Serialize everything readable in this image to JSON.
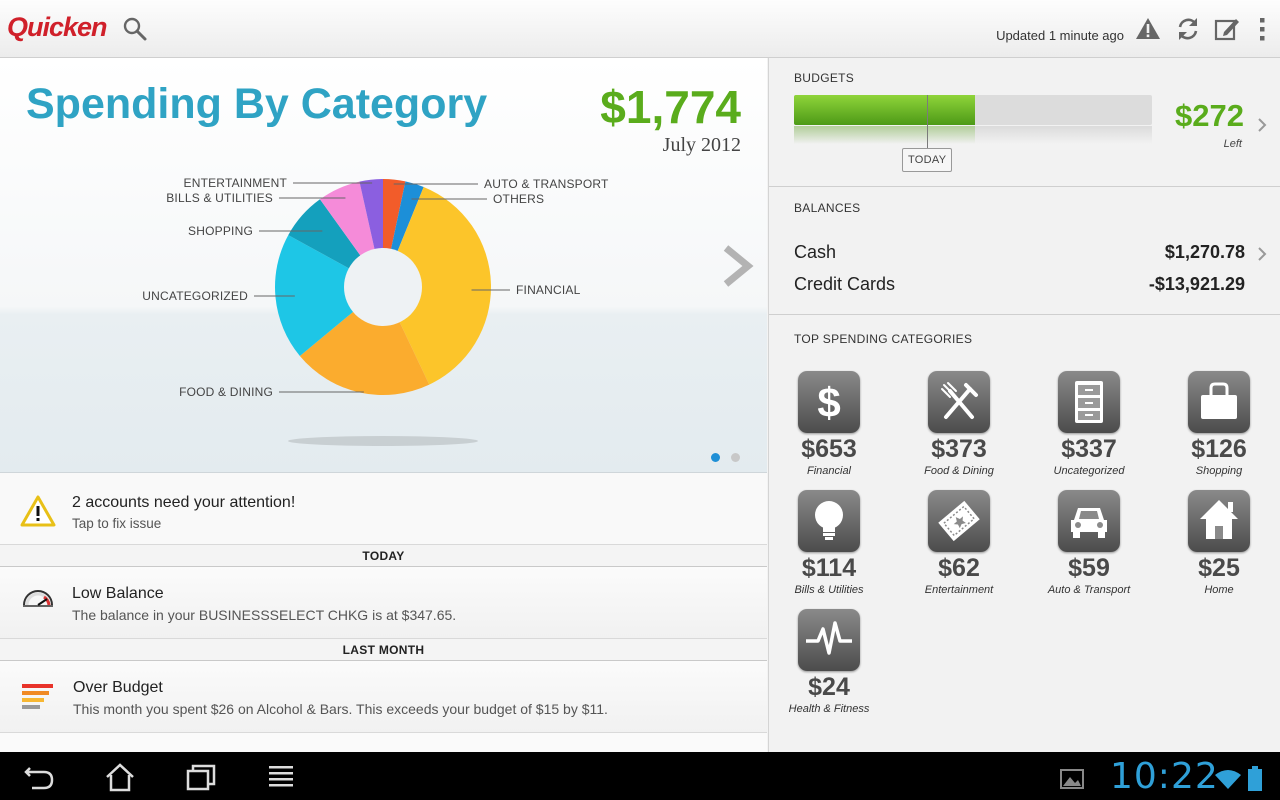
{
  "app": {
    "logo": "Quicken",
    "updated_text": "Updated 1 minute ago"
  },
  "icons": {
    "search": "search-icon",
    "warning": "warning-icon",
    "refresh": "refresh-icon",
    "edit": "edit-icon",
    "overflow": "overflow-menu-icon"
  },
  "colors": {
    "accent_blue": "#2fa3c4",
    "accent_green": "#5aac1c",
    "brand_red": "#d0202a"
  },
  "chart": {
    "title": "Spending By Category",
    "total": "$1,774",
    "period": "July 2012",
    "page": 1,
    "pages": 2
  },
  "chart_data": {
    "type": "pie",
    "title": "Spending By Category",
    "categories": [
      "FINANCIAL",
      "FOOD & DINING",
      "UNCATEGORIZED",
      "SHOPPING",
      "BILLS & UTILITIES",
      "ENTERTAINMENT",
      "AUTO & TRANSPORT",
      "OTHERS"
    ],
    "values": [
      653,
      373,
      337,
      126,
      114,
      62,
      59,
      50
    ],
    "colors": [
      "#fcc52a",
      "#fbac2e",
      "#1ec6e6",
      "#14a0bd",
      "#f58bd9",
      "#8b5fe0",
      "#f25c2a",
      "#1c8fd8"
    ],
    "donut": true
  },
  "alerts": {
    "attention_title": "2 accounts need your attention!",
    "attention_sub": "Tap to fix issue",
    "sections": [
      {
        "header": "TODAY",
        "title": "Low Balance",
        "text": "The balance in your BUSINESSSELECT CHKG is at $347.65."
      },
      {
        "header": "LAST MONTH",
        "title": "Over Budget",
        "text": "This month you spent $26 on Alcohol & Bars. This exceeds your budget of $15 by $11."
      }
    ]
  },
  "budgets": {
    "header": "BUDGETS",
    "amount": "$272",
    "left_label": "Left",
    "today_label": "TODAY",
    "spent_fraction": 0.506,
    "today_fraction": 0.372
  },
  "balances": {
    "header": "BALANCES",
    "items": [
      {
        "name": "Cash",
        "value": "$1,270.78"
      },
      {
        "name": "Credit Cards",
        "value": "-$13,921.29"
      }
    ]
  },
  "top_spending": {
    "header": "TOP SPENDING CATEGORIES",
    "items": [
      {
        "amount": "$653",
        "name": "Financial",
        "icon": "dollar-icon"
      },
      {
        "amount": "$373",
        "name": "Food & Dining",
        "icon": "fork-knife-icon"
      },
      {
        "amount": "$337",
        "name": "Uncategorized",
        "icon": "cabinet-icon"
      },
      {
        "amount": "$126",
        "name": "Shopping",
        "icon": "shopping-bag-icon"
      },
      {
        "amount": "$114",
        "name": "Bills & Utilities",
        "icon": "lightbulb-icon"
      },
      {
        "amount": "$62",
        "name": "Entertainment",
        "icon": "ticket-icon"
      },
      {
        "amount": "$59",
        "name": "Auto & Transport",
        "icon": "car-icon"
      },
      {
        "amount": "$25",
        "name": "Home",
        "icon": "house-icon"
      },
      {
        "amount": "$24",
        "name": "Health & Fitness",
        "icon": "heartbeat-icon"
      }
    ]
  },
  "system": {
    "time": "10:22"
  }
}
